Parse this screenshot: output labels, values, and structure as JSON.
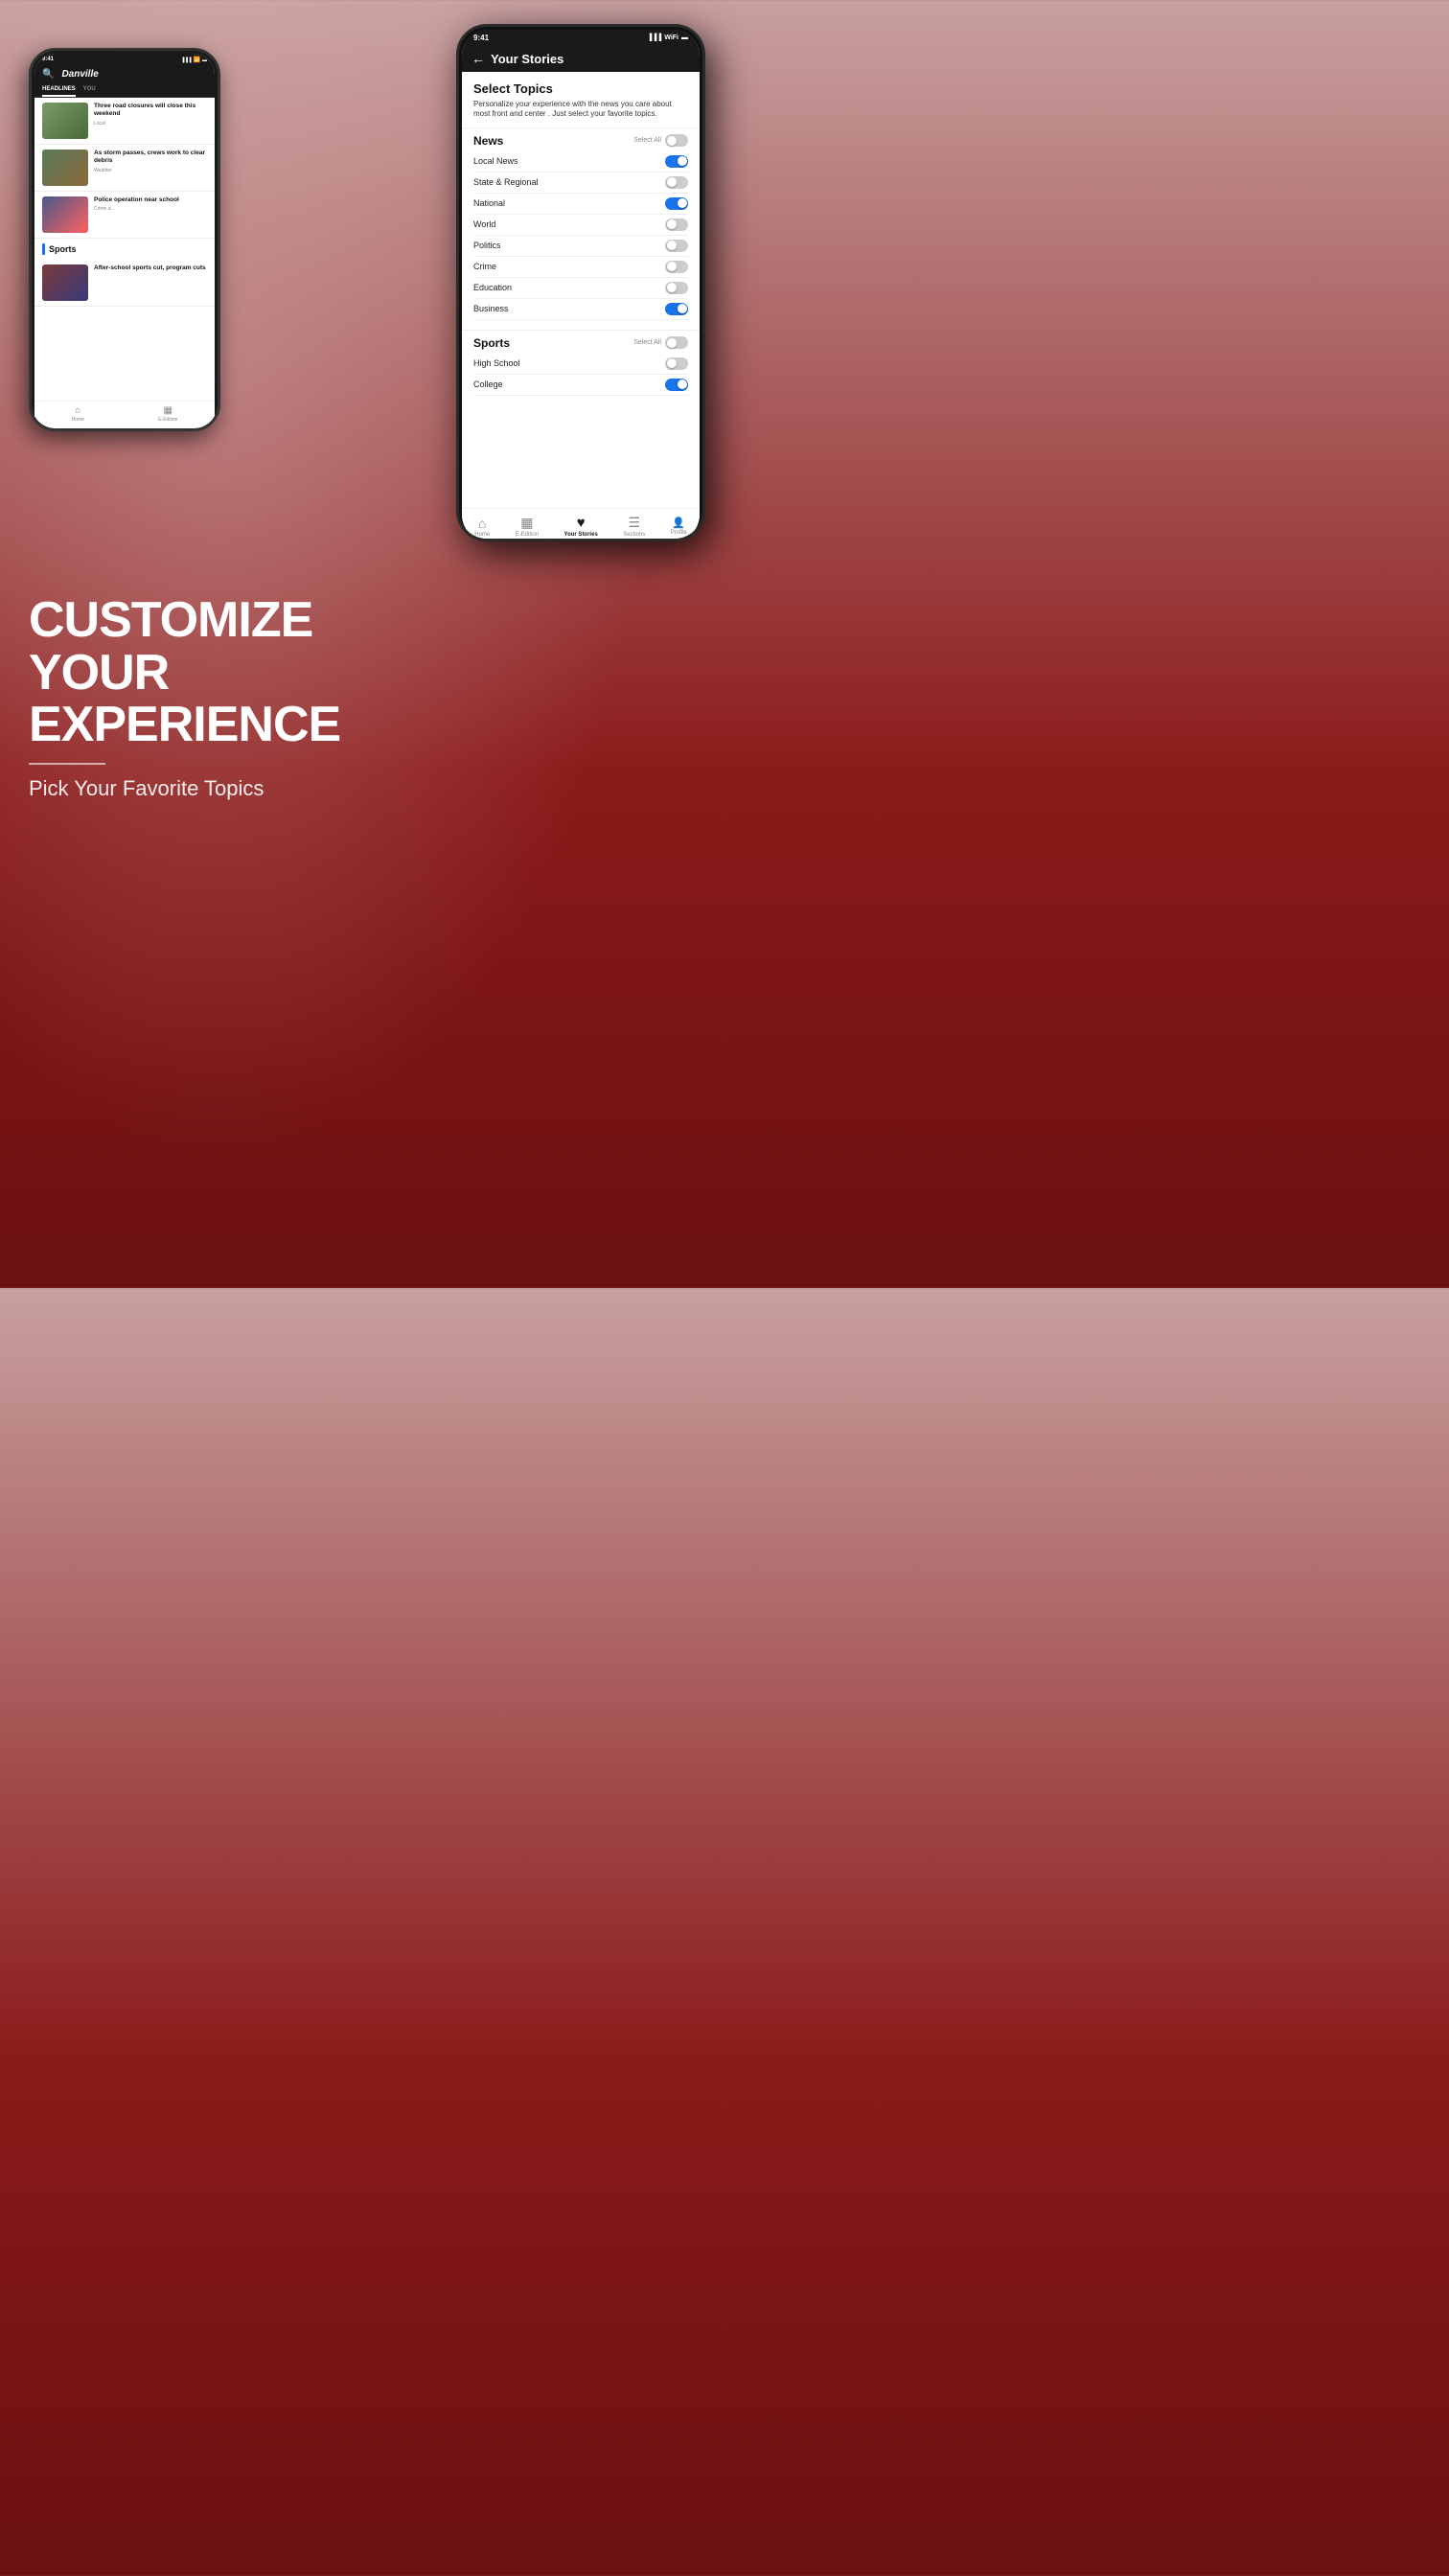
{
  "app": {
    "title": "Your Stories",
    "status_time": "9:41",
    "back_button_label": "←"
  },
  "select_topics": {
    "title": "Select Topics",
    "description": "Personalize your experience with the news you care about most front and center . Just select your favorite topics."
  },
  "news_section": {
    "title": "News",
    "select_all": "Select All",
    "items": [
      {
        "label": "Local News",
        "enabled": true
      },
      {
        "label": "State & Regional",
        "enabled": false
      },
      {
        "label": "National",
        "enabled": true
      },
      {
        "label": "World",
        "enabled": false
      },
      {
        "label": "Politics",
        "enabled": false
      },
      {
        "label": "Crime",
        "enabled": false
      },
      {
        "label": "Education",
        "enabled": false
      },
      {
        "label": "Business",
        "enabled": true
      }
    ]
  },
  "sports_section": {
    "title": "Sports",
    "select_all": "Select All",
    "items": [
      {
        "label": "High School",
        "enabled": false
      },
      {
        "label": "College",
        "enabled": true
      }
    ]
  },
  "bottom_nav": {
    "items": [
      {
        "label": "Home",
        "icon": "⌂",
        "active": false
      },
      {
        "label": "E-Edition",
        "icon": "▦",
        "active": false
      },
      {
        "label": "Your Stories",
        "icon": "♡",
        "active": true
      },
      {
        "label": "Sections",
        "icon": "☰",
        "active": false
      },
      {
        "label": "Profile",
        "icon": "◯",
        "active": false
      }
    ]
  },
  "back_phone": {
    "status_time": "9:41",
    "logo": "Danville",
    "tabs": [
      "HEADLINES",
      "YOU"
    ],
    "news_items": [
      {
        "title": "Three road closures will close this weekend",
        "tag": "Local"
      },
      {
        "title": "As storm passes, crews work to clear debris",
        "tag": "Weather"
      },
      {
        "title": "Police operation near school",
        "tag": "Crime a..."
      }
    ],
    "sports_section": "Sports",
    "sports_caption": "After-school sports cut, program cuts",
    "nav_items": [
      "Home",
      "E-Edition"
    ]
  },
  "promo_text": {
    "line1": "CUSTOMIZE",
    "line2": "YOUR",
    "line3": "EXPERIENCE",
    "subline": "Pick Your Favorite Topics"
  },
  "colors": {
    "accent_blue": "#1a73e8",
    "dark_bg": "#1a1a1a",
    "brand_red": "#8b1a1a"
  }
}
